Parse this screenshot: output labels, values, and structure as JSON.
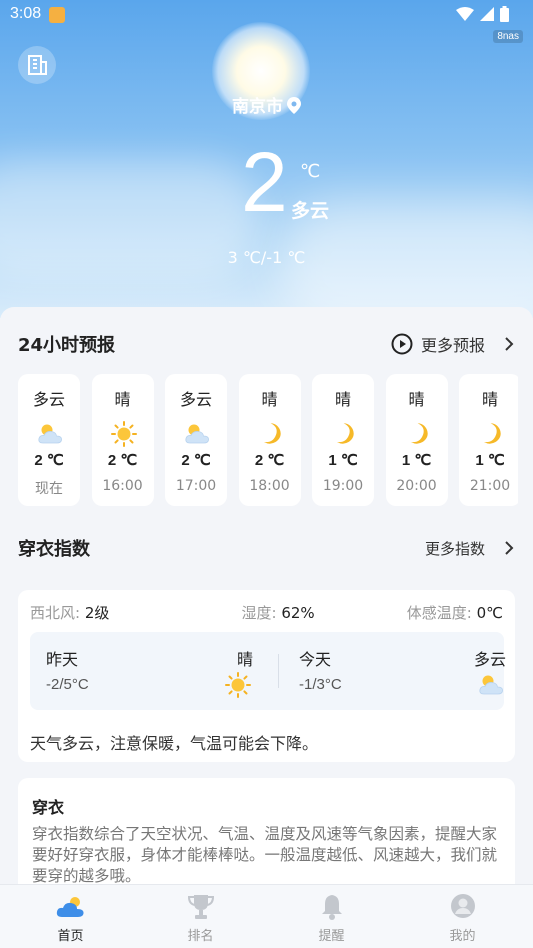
{
  "status_bar": {
    "time": "3:08",
    "label": "8nas"
  },
  "header": {
    "city": "南京市",
    "temperature": "2",
    "unit": "℃",
    "condition": "多云",
    "range": "3 ℃/-1 ℃"
  },
  "hourly": {
    "title": "24小时预报",
    "more": "更多预报",
    "items": [
      {
        "condition": "多云",
        "icon": "partly-cloudy-icon",
        "temp": "2 ℃",
        "time": "现在"
      },
      {
        "condition": "晴",
        "icon": "sun-icon",
        "temp": "2 ℃",
        "time": "16:00"
      },
      {
        "condition": "多云",
        "icon": "partly-cloudy-icon",
        "temp": "2 ℃",
        "time": "17:00"
      },
      {
        "condition": "晴",
        "icon": "moon-icon",
        "temp": "2 ℃",
        "time": "18:00"
      },
      {
        "condition": "晴",
        "icon": "moon-icon",
        "temp": "1 ℃",
        "time": "19:00"
      },
      {
        "condition": "晴",
        "icon": "moon-icon",
        "temp": "1 ℃",
        "time": "20:00"
      },
      {
        "condition": "晴",
        "icon": "moon-icon",
        "temp": "1 ℃",
        "time": "21:00"
      }
    ]
  },
  "clothing_index": {
    "title": "穿衣指数",
    "more": "更多指数",
    "wind_label": "西北风:",
    "wind_value": "2级",
    "humidity_label": "湿度:",
    "humidity_value": "62%",
    "feels_label": "体感温度:",
    "feels_value": "0℃",
    "yesterday": {
      "label": "昨天",
      "range": "-2/5°C",
      "condition": "晴"
    },
    "today": {
      "label": "今天",
      "range": "-1/3°C",
      "condition": "多云"
    },
    "tip": "天气多云，注意保暖，气温可能会下降。"
  },
  "clothing_desc": {
    "title": "穿衣",
    "body": "穿衣指数综合了天空状况、气温、温度及风速等气象因素，提醒大家要好好穿衣服，身体才能棒棒哒。一般温度越低、风速越大，我们就要穿的越多哦。"
  },
  "tabs": [
    {
      "label": "首页"
    },
    {
      "label": "排名"
    },
    {
      "label": "提醒"
    },
    {
      "label": "我的"
    }
  ]
}
